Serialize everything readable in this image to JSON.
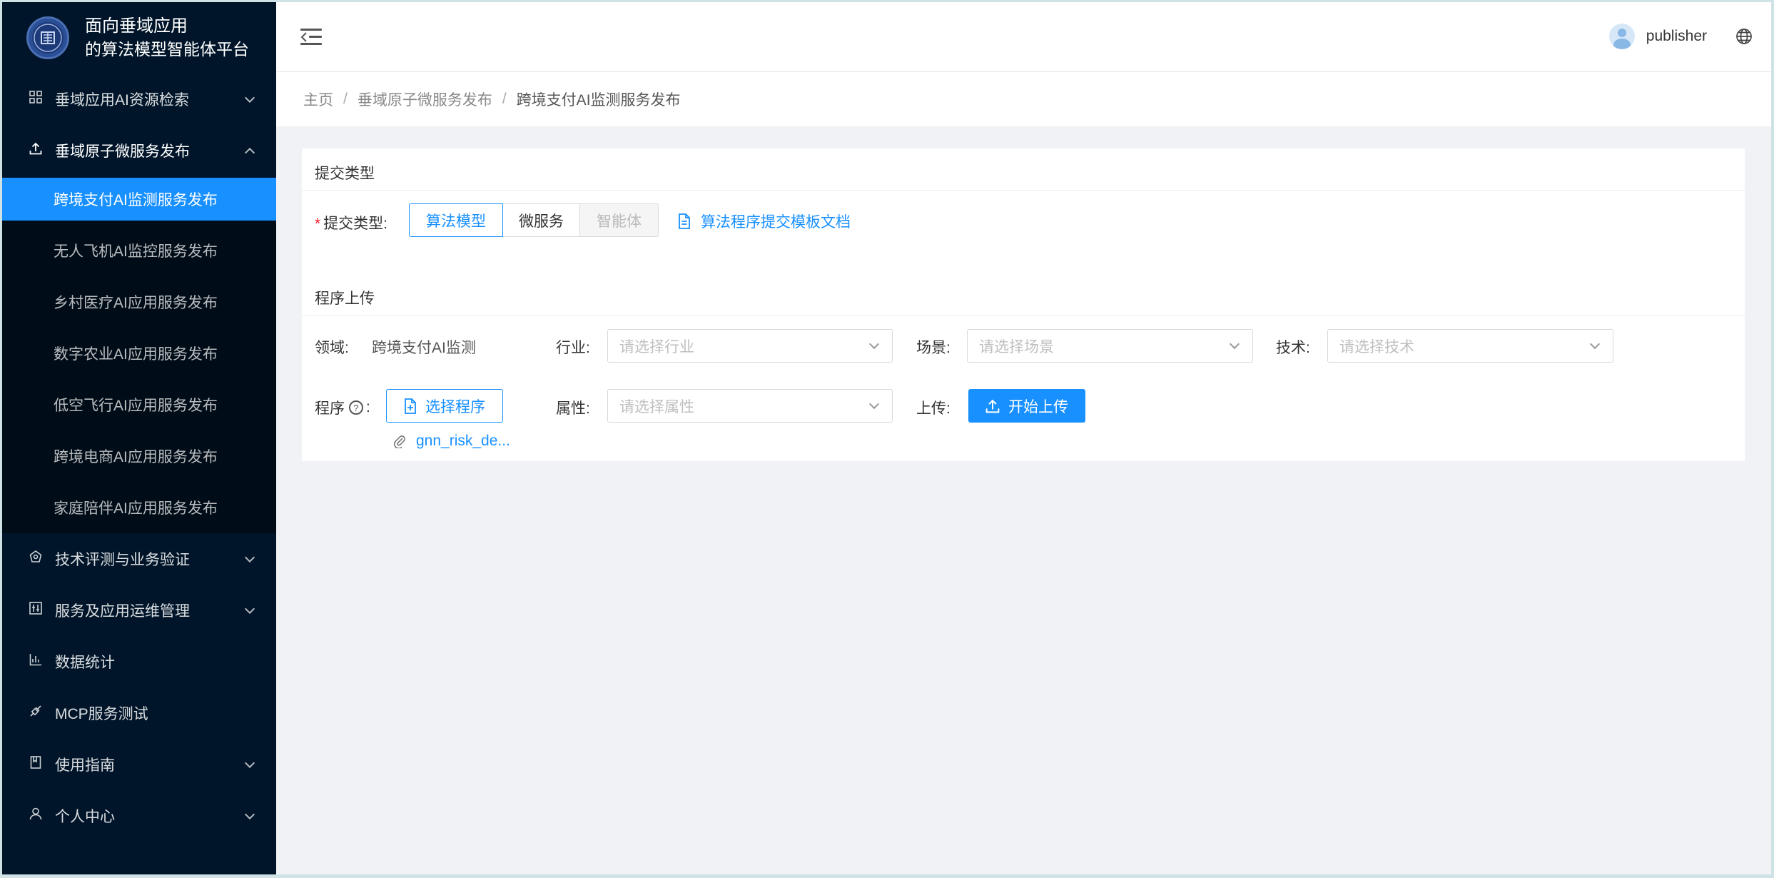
{
  "app": {
    "title_line1": "面向垂域应用",
    "title_line2": "的算法模型智能体平台"
  },
  "sidebar": {
    "items": [
      {
        "label": "垂域应用AI资源检索",
        "icon": "appstore-icon",
        "expandable": true,
        "open": false
      },
      {
        "label": "垂域原子微服务发布",
        "icon": "upload-icon",
        "expandable": true,
        "open": true
      },
      {
        "label": "技术评测与业务验证",
        "icon": "experiment-icon",
        "expandable": true,
        "open": false
      },
      {
        "label": "服务及应用运维管理",
        "icon": "control-icon",
        "expandable": true,
        "open": false
      },
      {
        "label": "数据统计",
        "icon": "bar-chart-icon",
        "expandable": false,
        "open": false
      },
      {
        "label": "MCP服务测试",
        "icon": "api-icon",
        "expandable": false,
        "open": false
      },
      {
        "label": "使用指南",
        "icon": "book-icon",
        "expandable": true,
        "open": false
      },
      {
        "label": "个人中心",
        "icon": "user-icon",
        "expandable": true,
        "open": false
      }
    ],
    "submenu": [
      {
        "label": "跨境支付AI监测服务发布",
        "active": true
      },
      {
        "label": "无人飞机AI监控服务发布",
        "active": false
      },
      {
        "label": "乡村医疗AI应用服务发布",
        "active": false
      },
      {
        "label": "数字农业AI应用服务发布",
        "active": false
      },
      {
        "label": "低空飞行AI应用服务发布",
        "active": false
      },
      {
        "label": "跨境电商AI应用服务发布",
        "active": false
      },
      {
        "label": "家庭陪伴AI应用服务发布",
        "active": false
      }
    ]
  },
  "header": {
    "username": "publisher"
  },
  "breadcrumb": [
    "主页",
    "垂域原子微服务发布",
    "跨境支付AI监测服务发布"
  ],
  "form": {
    "section1_title": "提交类型",
    "type_label": "提交类型:",
    "type_options": [
      "算法模型",
      "微服务",
      "智能体"
    ],
    "type_selected": "算法模型",
    "template_link": "算法程序提交模板文档",
    "section2_title": "程序上传",
    "domain_label": "领域:",
    "domain_value": "跨境支付AI监测",
    "industry_label": "行业:",
    "industry_placeholder": "请选择行业",
    "scene_label": "场景:",
    "scene_placeholder": "请选择场景",
    "tech_label": "技术:",
    "tech_placeholder": "请选择技术",
    "program_label": "程序",
    "program_colon": ":",
    "select_program_button": "选择程序",
    "attr_label": "属性:",
    "attr_placeholder": "请选择属性",
    "upload_label": "上传:",
    "upload_button": "开始上传",
    "file_name": "gnn_risk_de..."
  },
  "colors": {
    "sidebar_bg": "#001529",
    "submenu_bg": "#000c17",
    "accent": "#1890ff",
    "required": "#f5222d"
  }
}
